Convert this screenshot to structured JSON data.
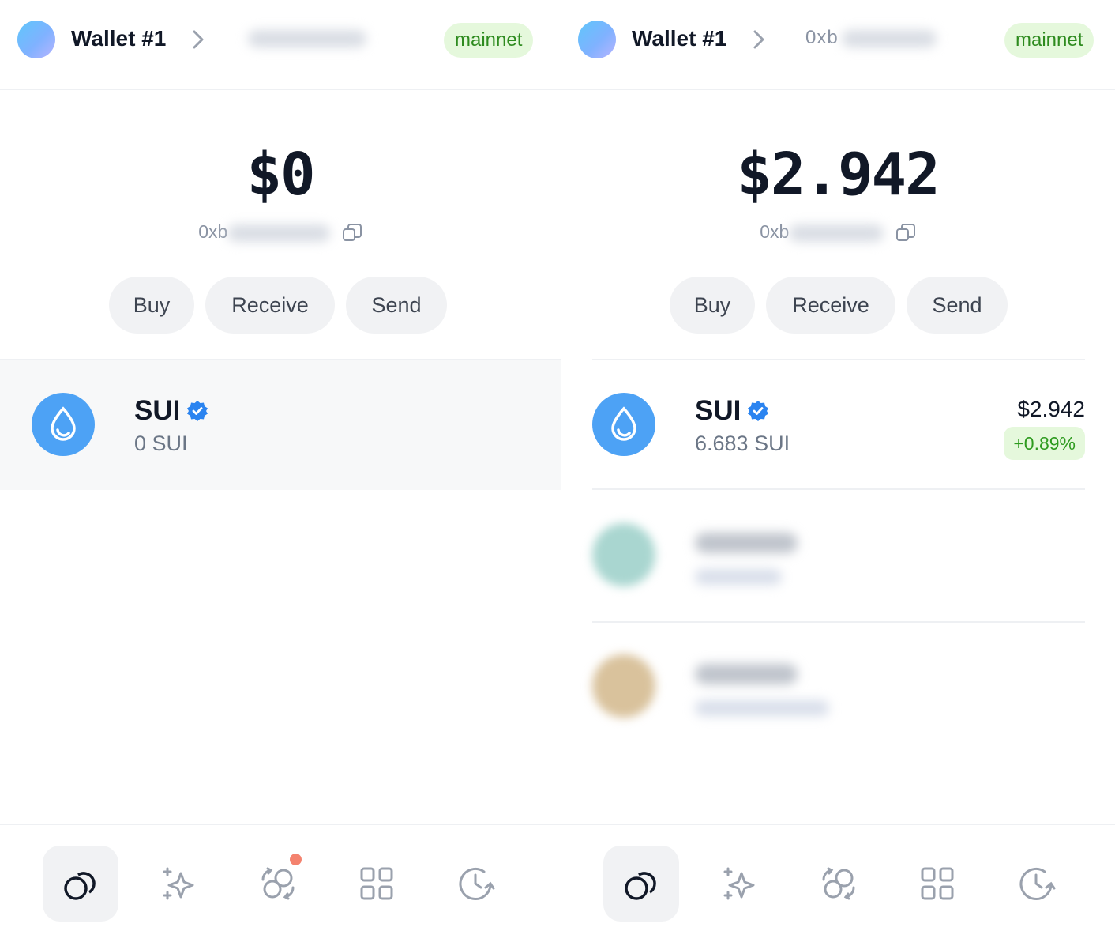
{
  "panels": [
    {
      "wallet_name": "Wallet #1",
      "header_address": "",
      "network": "mainnet",
      "balance": "$0",
      "address_prefix": "0xb",
      "actions": {
        "buy": "Buy",
        "receive": "Receive",
        "send": "Send"
      },
      "token": {
        "symbol": "SUI",
        "amount": "0 SUI"
      },
      "nav_badge_on": "swap"
    },
    {
      "wallet_name": "Wallet #1",
      "header_address": "0xb",
      "network": "mainnet",
      "balance": "$2.942",
      "address_prefix": "0xb",
      "actions": {
        "buy": "Buy",
        "receive": "Receive",
        "send": "Send"
      },
      "token": {
        "symbol": "SUI",
        "amount": "6.683 SUI",
        "usd_value": "$2.942",
        "change": "+0.89%"
      }
    }
  ],
  "nav": [
    "coins-icon",
    "sparkle-icon",
    "swap-icon",
    "apps-grid-icon",
    "history-icon"
  ],
  "colors": {
    "accent_blue": "#4da2f5",
    "network_badge_bg": "#e5f8dc",
    "network_badge_text": "#2e8b1f",
    "notification_dot": "#f4826e"
  }
}
